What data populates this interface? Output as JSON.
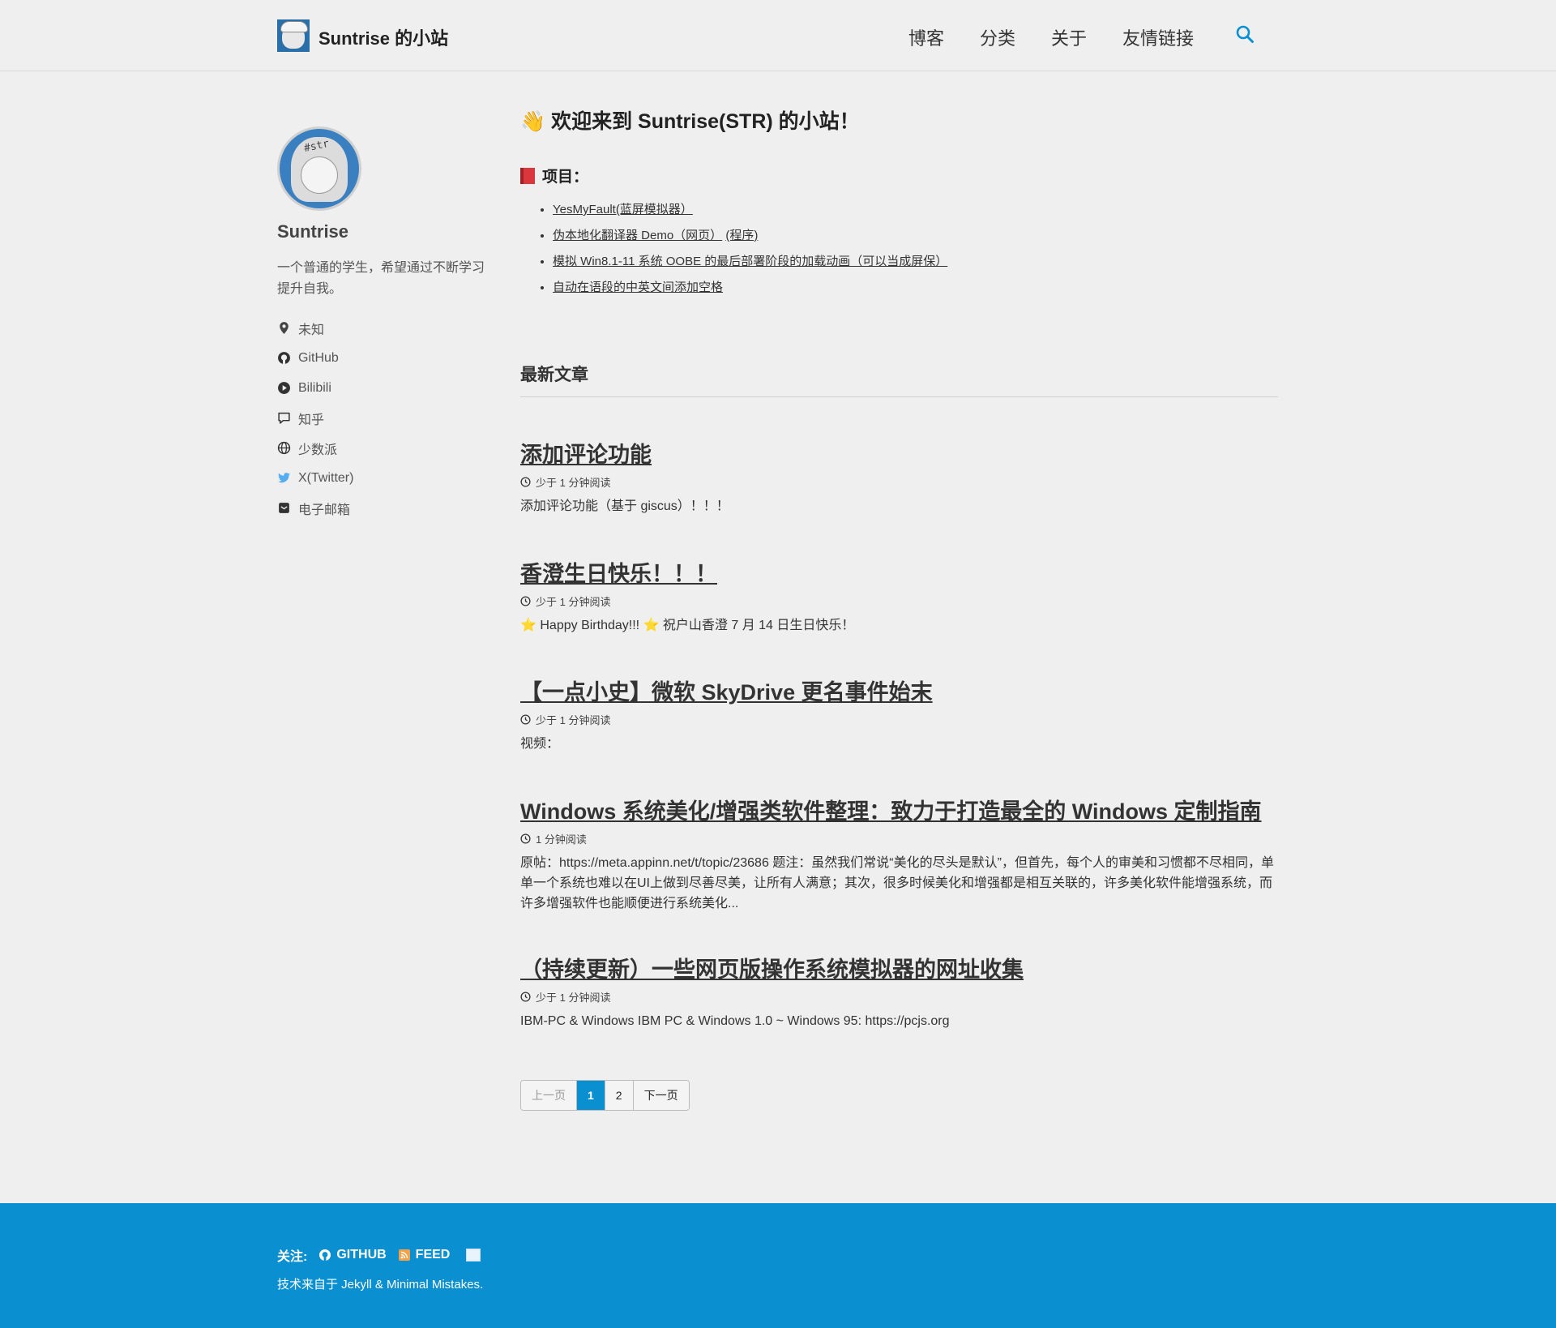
{
  "header": {
    "site_title": "Suntrise 的小站",
    "nav": [
      "博客",
      "分类",
      "关于",
      "友情链接"
    ]
  },
  "sidebar": {
    "author_name": "Suntrise",
    "avatar_text": "#str",
    "bio": "一个普通的学生，希望通过不断学习提升自我。",
    "links": [
      {
        "icon": "location-icon",
        "label": "未知"
      },
      {
        "icon": "github-icon",
        "label": "GitHub"
      },
      {
        "icon": "play-icon",
        "label": "Bilibili"
      },
      {
        "icon": "comment-icon",
        "label": "知乎"
      },
      {
        "icon": "globe-icon",
        "label": "少数派"
      },
      {
        "icon": "twitter-icon",
        "label": "X(Twitter)"
      },
      {
        "icon": "email-icon",
        "label": "电子邮箱"
      }
    ]
  },
  "main": {
    "welcome": "👋 欢迎来到 Suntrise(STR) 的小站！",
    "projects_heading": "项目：",
    "projects": [
      {
        "text": "YesMyFault(蓝屏模拟器）"
      },
      {
        "text": "伪本地化翻译器 Demo（网页）",
        "extra": "(程序)"
      },
      {
        "text": "模拟 Win8.1-11 系统 OOBE 的最后部署阶段的加载动画（可以当成屏保）"
      },
      {
        "text": "自动在语段的中英文间添加空格"
      }
    ],
    "recent_title": "最新文章",
    "posts": [
      {
        "title": "添加评论功能",
        "meta": "少于 1 分钟阅读",
        "excerpt": "添加评论功能（基于 giscus）！！！"
      },
      {
        "title": "香澄生日快乐！！！",
        "meta": "少于 1 分钟阅读",
        "excerpt": "⭐ Happy Birthday!!! ⭐ 祝户山香澄 7 月 14 日生日快乐！"
      },
      {
        "title": "【一点小史】微软 SkyDrive 更名事件始末",
        "meta": "少于 1 分钟阅读",
        "excerpt": "视频："
      },
      {
        "title": "Windows 系统美化/增强类软件整理：致力于打造最全的 Windows 定制指南",
        "meta": "1 分钟阅读",
        "excerpt": "原帖：https://meta.appinn.net/t/topic/23686 题注：虽然我们常说“美化的尽头是默认”，但首先，每个人的审美和习惯都不尽相同，单单一个系统也难以在UI上做到尽善尽美，让所有人满意；其次，很多时候美化和增强都是相互关联的，许多美化软件能增强系统，而许多增强软件也能顺便进行系统美化..."
      },
      {
        "title": "（持续更新）一些网页版操作系统模拟器的网址收集",
        "meta": "少于 1 分钟阅读",
        "excerpt": "IBM-PC & Windows IBM PC & Windows 1.0 ~ Windows 95: https://pcjs.org"
      }
    ],
    "pagination": {
      "prev": "上一页",
      "pages": [
        "1",
        "2"
      ],
      "current": "1",
      "next": "下一页"
    }
  },
  "footer": {
    "follow_label": "关注:",
    "github": "GITHUB",
    "feed": "FEED",
    "copyright": "技术来自于 Jekyll & Minimal Mistakes."
  },
  "colors": {
    "accent": "#0a8fd0",
    "background": "#efefef",
    "footer_bg": "#0a8fd0"
  }
}
